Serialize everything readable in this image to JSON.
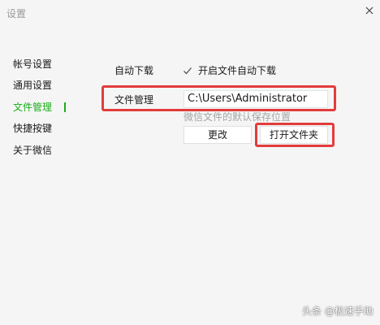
{
  "window": {
    "title": "设置"
  },
  "sidebar": {
    "items": [
      {
        "label": "帐号设置"
      },
      {
        "label": "通用设置"
      },
      {
        "label": "文件管理"
      },
      {
        "label": "快捷按键"
      },
      {
        "label": "关于微信"
      }
    ],
    "active_index": 2
  },
  "settings": {
    "auto_download": {
      "label": "自动下载",
      "checkbox_label": "开启文件自动下载",
      "checked": true
    },
    "file_management": {
      "label": "文件管理",
      "path_value": "C:\\Users\\Administrator",
      "hint": "微信文件的默认保存位置",
      "change_button": "更改",
      "open_folder_button": "打开文件夹"
    }
  },
  "colors": {
    "accent": "#1aad19",
    "highlight": "#e23c3c"
  },
  "icons": {
    "close": "close-icon",
    "check": "check-icon"
  },
  "watermark": "头条 @极速手助"
}
